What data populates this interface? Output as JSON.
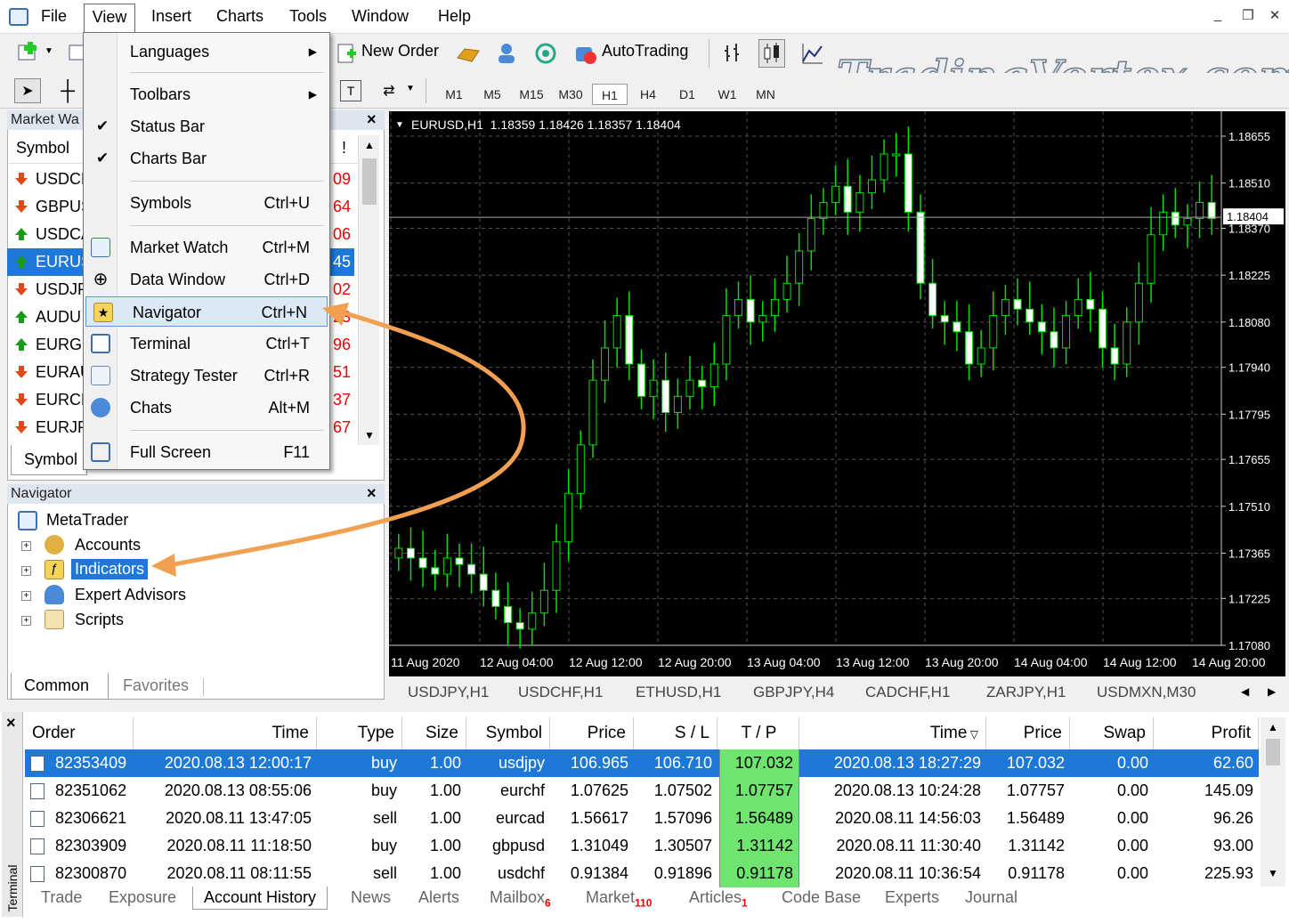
{
  "menubar": {
    "items": [
      "File",
      "View",
      "Insert",
      "Charts",
      "Tools",
      "Window",
      "Help"
    ]
  },
  "watermark": "TradingVortex.com",
  "toolbar": {
    "new_order": "New Order",
    "autotrading": "AutoTrading",
    "timeframes": [
      "M1",
      "M5",
      "M15",
      "M30",
      "H1",
      "H4",
      "D1",
      "W1",
      "MN"
    ],
    "selected_timeframe": "H1"
  },
  "market_watch": {
    "title": "Market Wa",
    "column": "Symbol",
    "column_right": "!",
    "tab": "Symbol",
    "rows": [
      {
        "symbol": "USDCH",
        "value": "09",
        "dir": "down"
      },
      {
        "symbol": "GBPUS",
        "value": "64",
        "dir": "down"
      },
      {
        "symbol": "USDCA",
        "value": "06",
        "dir": "up"
      },
      {
        "symbol": "EURUS",
        "value": "45",
        "dir": "up",
        "selected": true
      },
      {
        "symbol": "USDJP",
        "value": "02",
        "dir": "down"
      },
      {
        "symbol": "AUDU",
        "value": "23",
        "dir": "up"
      },
      {
        "symbol": "EURGE",
        "value": "96",
        "dir": "up"
      },
      {
        "symbol": "EURAU",
        "value": "51",
        "dir": "down"
      },
      {
        "symbol": "EURCH",
        "value": "37",
        "dir": "down"
      },
      {
        "symbol": "EURJP",
        "value": "67",
        "dir": "down"
      }
    ]
  },
  "view_menu": {
    "items": [
      {
        "label": "Languages",
        "shortcut": "",
        "submenu": true
      },
      {
        "label": "Toolbars",
        "shortcut": "",
        "submenu": true
      },
      {
        "label": "Status Bar",
        "shortcut": "",
        "checked": true
      },
      {
        "label": "Charts Bar",
        "shortcut": "",
        "checked": true
      },
      {
        "label": "Symbols",
        "shortcut": "Ctrl+U"
      },
      {
        "label": "Market Watch",
        "shortcut": "Ctrl+M"
      },
      {
        "label": "Data Window",
        "shortcut": "Ctrl+D"
      },
      {
        "label": "Navigator",
        "shortcut": "Ctrl+N",
        "highlighted": true
      },
      {
        "label": "Terminal",
        "shortcut": "Ctrl+T"
      },
      {
        "label": "Strategy Tester",
        "shortcut": "Ctrl+R"
      },
      {
        "label": "Chats",
        "shortcut": "Alt+M"
      },
      {
        "label": "Full Screen",
        "shortcut": "F11"
      }
    ]
  },
  "navigator": {
    "title": "Navigator",
    "root": "MetaTrader",
    "items": [
      "Accounts",
      "Indicators",
      "Expert Advisors",
      "Scripts"
    ],
    "selected": "Indicators",
    "tabs": [
      "Common",
      "Favorites"
    ]
  },
  "chart": {
    "header": "EURUSD,H1  1.18359 1.18426 1.18357 1.18404",
    "current_price": "1.18404",
    "price_ticks": [
      "1.18655",
      "1.18510",
      "1.18370",
      "1.18225",
      "1.18080",
      "1.17940",
      "1.17795",
      "1.17655",
      "1.17510",
      "1.17365",
      "1.17225",
      "1.17080"
    ],
    "time_ticks": [
      "11 Aug 2020",
      "12 Aug 04:00",
      "12 Aug 12:00",
      "12 Aug 20:00",
      "13 Aug 04:00",
      "13 Aug 12:00",
      "13 Aug 20:00",
      "14 Aug 04:00",
      "14 Aug 12:00",
      "14 Aug 20:00"
    ],
    "tabs": [
      "USDJPY,H1",
      "USDCHF,H1",
      "ETHUSD,H1",
      "GBPJPY,H4",
      "CADCHF,H1",
      "ZARJPY,H1",
      "USDMXN,M30"
    ]
  },
  "chart_data": {
    "type": "candlestick",
    "symbol": "EURUSD",
    "timeframe": "H1",
    "ylim": [
      1.1708,
      1.18655
    ],
    "close_approx": [
      1.1738,
      1.1735,
      1.1732,
      1.173,
      1.1735,
      1.1733,
      1.173,
      1.1725,
      1.172,
      1.1715,
      1.1713,
      1.1718,
      1.1725,
      1.174,
      1.1755,
      1.177,
      1.179,
      1.18,
      1.181,
      1.1795,
      1.1785,
      1.179,
      1.178,
      1.1785,
      1.179,
      1.1788,
      1.1795,
      1.181,
      1.1815,
      1.1808,
      1.181,
      1.1815,
      1.182,
      1.183,
      1.184,
      1.1845,
      1.185,
      1.1842,
      1.1848,
      1.1852,
      1.186,
      1.186,
      1.1842,
      1.182,
      1.181,
      1.1808,
      1.1805,
      1.1795,
      1.18,
      1.181,
      1.1815,
      1.1812,
      1.1808,
      1.1805,
      1.18,
      1.181,
      1.1815,
      1.1812,
      1.18,
      1.1795,
      1.1808,
      1.182,
      1.1835,
      1.1842,
      1.1838,
      1.184,
      1.1845,
      1.184
    ]
  },
  "terminal": {
    "side_label": "Terminal",
    "columns": [
      "Order",
      "Time",
      "Type",
      "Size",
      "Symbol",
      "Price",
      "S / L",
      "T / P",
      "Time",
      "Price",
      "Swap",
      "Profit"
    ],
    "rows": [
      [
        "82353409",
        "2020.08.13 12:00:17",
        "buy",
        "1.00",
        "usdjpy",
        "106.965",
        "106.710",
        "107.032",
        "2020.08.13 18:27:29",
        "107.032",
        "0.00",
        "62.60"
      ],
      [
        "82351062",
        "2020.08.13 08:55:06",
        "buy",
        "1.00",
        "eurchf",
        "1.07625",
        "1.07502",
        "1.07757",
        "2020.08.13 10:24:28",
        "1.07757",
        "0.00",
        "145.09"
      ],
      [
        "82306621",
        "2020.08.11 13:47:05",
        "sell",
        "1.00",
        "eurcad",
        "1.56617",
        "1.57096",
        "1.56489",
        "2020.08.11 14:56:03",
        "1.56489",
        "0.00",
        "96.26"
      ],
      [
        "82303909",
        "2020.08.11 11:18:50",
        "buy",
        "1.00",
        "gbpusd",
        "1.31049",
        "1.30507",
        "1.31142",
        "2020.08.11 11:30:40",
        "1.31142",
        "0.00",
        "93.00"
      ],
      [
        "82300870",
        "2020.08.11 08:11:55",
        "sell",
        "1.00",
        "usdchf",
        "0.91384",
        "0.91896",
        "0.91178",
        "2020.08.11 10:36:54",
        "0.91178",
        "0.00",
        "225.93"
      ]
    ],
    "tabs": [
      {
        "label": "Trade"
      },
      {
        "label": "Exposure"
      },
      {
        "label": "Account History",
        "active": true
      },
      {
        "label": "News"
      },
      {
        "label": "Alerts"
      },
      {
        "label": "Mailbox",
        "badge": "6"
      },
      {
        "label": "Market",
        "badge": "110"
      },
      {
        "label": "Articles",
        "badge": "1"
      },
      {
        "label": "Code Base"
      },
      {
        "label": "Experts"
      },
      {
        "label": "Journal"
      }
    ]
  },
  "colors": {
    "selection": "#1e78d7",
    "bull": "#00e000",
    "chart_bg": "#000000",
    "tp_highlight": "#6fe46f",
    "arrow": "#f0a050"
  }
}
